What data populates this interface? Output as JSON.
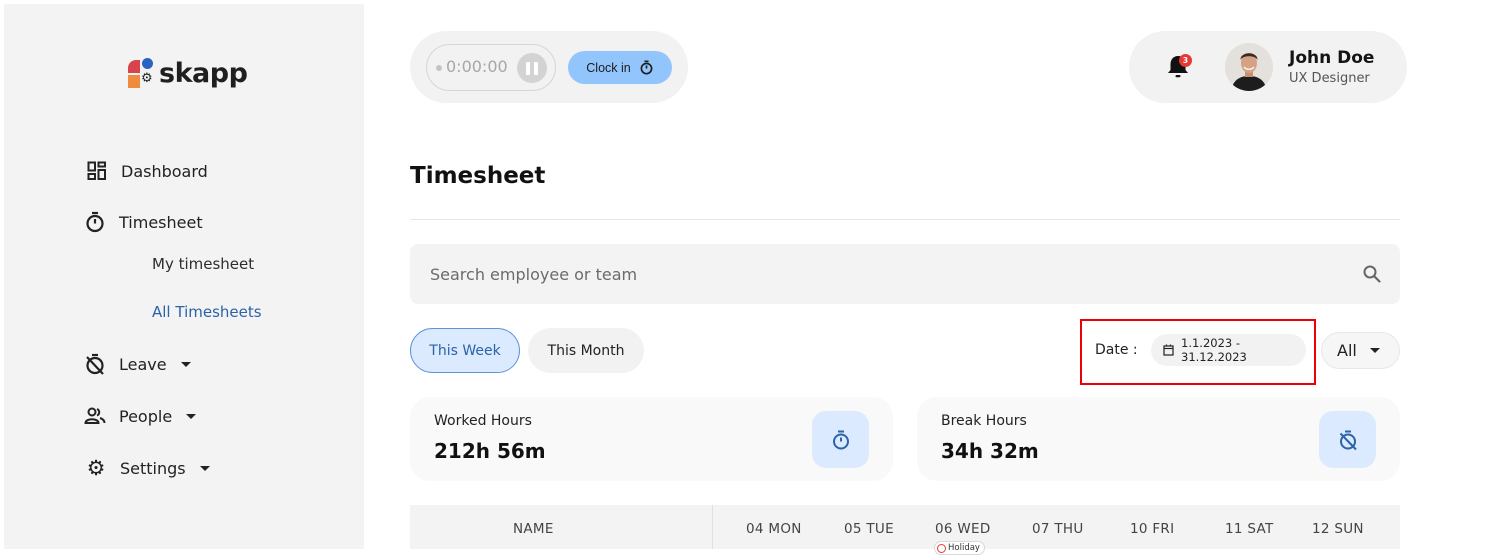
{
  "app": {
    "logo_text": "skapp"
  },
  "sidebar": {
    "items": [
      {
        "label": "Dashboard",
        "icon": "dashboard-icon"
      },
      {
        "label": "Timesheet",
        "icon": "stopwatch-icon"
      },
      {
        "label": "Leave",
        "icon": "leave-timer-off-icon",
        "has_caret": true
      },
      {
        "label": "People",
        "icon": "people-icon",
        "has_caret": true
      },
      {
        "label": "Settings",
        "icon": "gear-icon",
        "has_caret": true
      }
    ],
    "timesheet_subitems": [
      {
        "label": "My timesheet",
        "active": false
      },
      {
        "label": "All Timesheets",
        "active": true
      }
    ]
  },
  "header": {
    "timer": "0:00:00",
    "clock_in_label": "Clock in",
    "notification_count": "3",
    "user": {
      "name": "John Doe",
      "role": "UX Designer"
    }
  },
  "main": {
    "title": "Timesheet",
    "search": {
      "placeholder": "Search employee or team",
      "value": ""
    },
    "tabs": [
      {
        "label": "This Week",
        "active": true
      },
      {
        "label": "This Month",
        "active": false
      }
    ],
    "date_filter": {
      "label": "Date :",
      "range": "1.1.2023 - 31.12.2023"
    },
    "team_select": {
      "value": "All"
    },
    "stats": [
      {
        "label": "Worked Hours",
        "value": "212h 56m",
        "icon": "stopwatch-icon"
      },
      {
        "label": "Break Hours",
        "value": "34h 32m",
        "icon": "timer-off-icon"
      }
    ],
    "table": {
      "columns": [
        "NAME",
        "04 MON",
        "05 TUE",
        "06 WED",
        "07 THU",
        "10 FRI",
        "11 SAT",
        "12 SUN"
      ],
      "holiday_chip": {
        "column": "06 WED",
        "label": "Holiday"
      }
    }
  },
  "colors": {
    "accent": "#2a63a8",
    "accent_light": "#dbeafe",
    "clock_in": "#93c5fd",
    "badge": "#e53935",
    "highlight_box": "#ee0000"
  }
}
